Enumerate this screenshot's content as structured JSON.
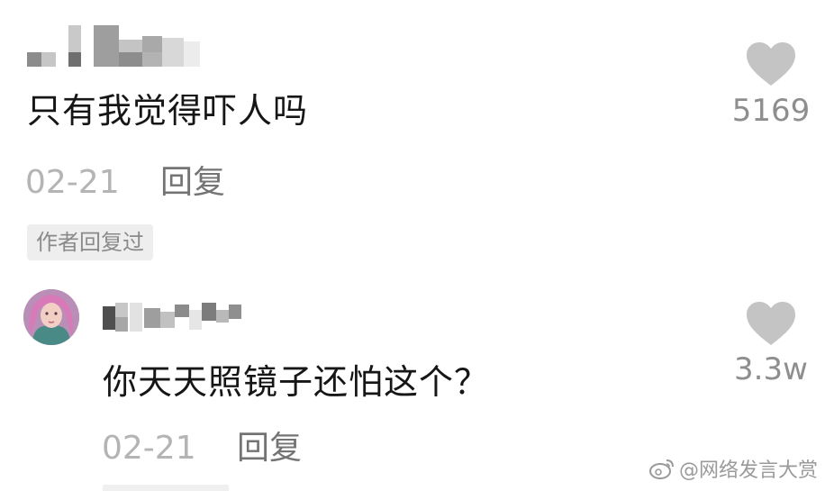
{
  "comments": [
    {
      "text": "只有我觉得吓人吗",
      "date": "02-21",
      "reply_label": "回复",
      "likes": "5169",
      "badge": "作者回复过"
    },
    {
      "text": "你天天照镜子还怕这个？",
      "date": "02-21",
      "reply_label": "回复",
      "likes": "3.3w"
    }
  ],
  "watermark": "@网络发言大赏",
  "icons": {
    "like": "heart-icon",
    "watermark_logo": "weibo-icon"
  },
  "colors": {
    "heart": "#c4c4c4",
    "text": "#161616",
    "muted": "#b4b4b4"
  }
}
